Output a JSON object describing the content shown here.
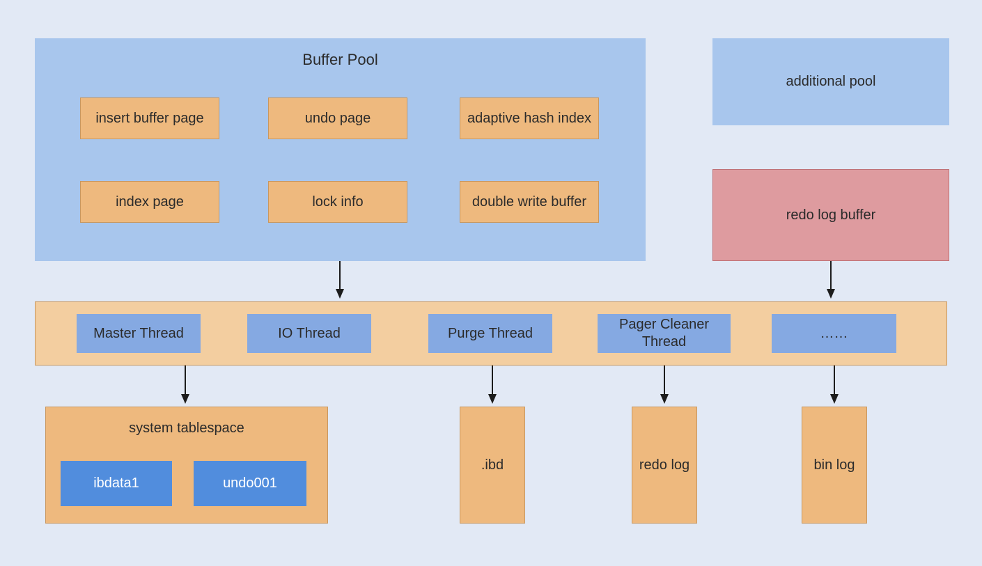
{
  "bufferPool": {
    "title": "Buffer Pool",
    "items": [
      "insert buffer page",
      "undo page",
      "adaptive hash index",
      "index page",
      "lock info",
      "double write buffer"
    ]
  },
  "additionalPool": "additional pool",
  "redoLogBuffer": "redo log buffer",
  "threads": [
    "Master Thread",
    "IO Thread",
    "Purge Thread",
    "Pager Cleaner Thread",
    "……"
  ],
  "systemTablespace": {
    "title": "system tablespace",
    "files": [
      "ibdata1",
      "undo001"
    ]
  },
  "storage": [
    ".ibd",
    "redo log",
    "bin log"
  ]
}
